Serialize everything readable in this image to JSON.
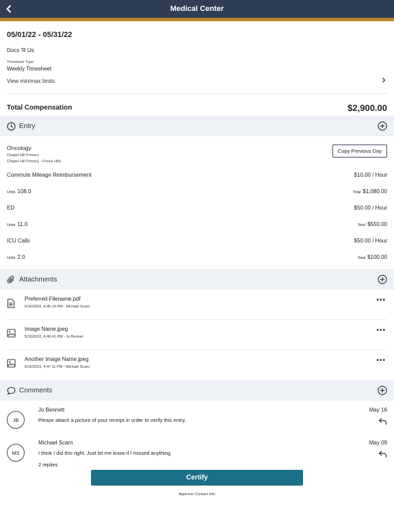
{
  "nav": {
    "title": "Medical Center"
  },
  "header": {
    "period": "05/01/22 - 05/31/22",
    "organization": "Docs 'R Us",
    "timesheet_type_label": "Timesheet Type:",
    "timesheet_type_value": "Weekly Timesheet",
    "limits_link": "View min/max limits"
  },
  "total": {
    "label": "Total Compensation",
    "value": "$2,900.00"
  },
  "entry": {
    "section_title": "Entry",
    "department": "Oncology",
    "locations": [
      "Chapel Hill Primary",
      "Chapel Hill Primary - Forest Hills"
    ],
    "copy_button": "Copy Previous Day",
    "units_label": "Units",
    "total_label": "Total",
    "items": [
      {
        "name": "Commute Mileage Reimbursement",
        "rate": "$10.00 / Hour",
        "units": "108.0",
        "total": "$1,080.00"
      },
      {
        "name": "ED",
        "rate": "$50.00 / Hour",
        "units": "11.0",
        "total": "$550.00"
      },
      {
        "name": "ICU Calls",
        "rate": "$50.00 / Hour",
        "units": "2.0",
        "total": "$100.00"
      }
    ]
  },
  "attachments": {
    "section_title": "Attachments",
    "items": [
      {
        "icon": "file-icon",
        "name": "Preferred Filename.pdf",
        "meta": "5/16/2022, 4:45:15 PM - Michael Scarn"
      },
      {
        "icon": "image-icon",
        "name": "Image Name.jpeg",
        "meta": "5/16/2022, 4:46:41 PM - Jo Bennet"
      },
      {
        "icon": "image-icon",
        "name": "Another Image Name.jpeg",
        "meta": "5/16/2022, 4:47:11 PM - Michael Scarn"
      }
    ]
  },
  "comments": {
    "section_title": "Comments",
    "items": [
      {
        "initials": "JB",
        "author": "Jo Bennett",
        "text": "Please attach a picture of your receipt in order to verify this entry.",
        "date": "May 16",
        "replies": ""
      },
      {
        "initials": "MS",
        "author": "Michael Scarn",
        "text": "I think I did this right. Just let me know if I missed anything.",
        "date": "May 09",
        "replies": "2 replies"
      }
    ]
  },
  "footer": {
    "certify_label": "Certify",
    "approver_link": "Approver Contact Info"
  },
  "colors": {
    "nav_bg": "#2f3d55",
    "accent_gold": "#b8862e",
    "primary_button": "#1b7088",
    "section_bg": "#eef1f5"
  }
}
